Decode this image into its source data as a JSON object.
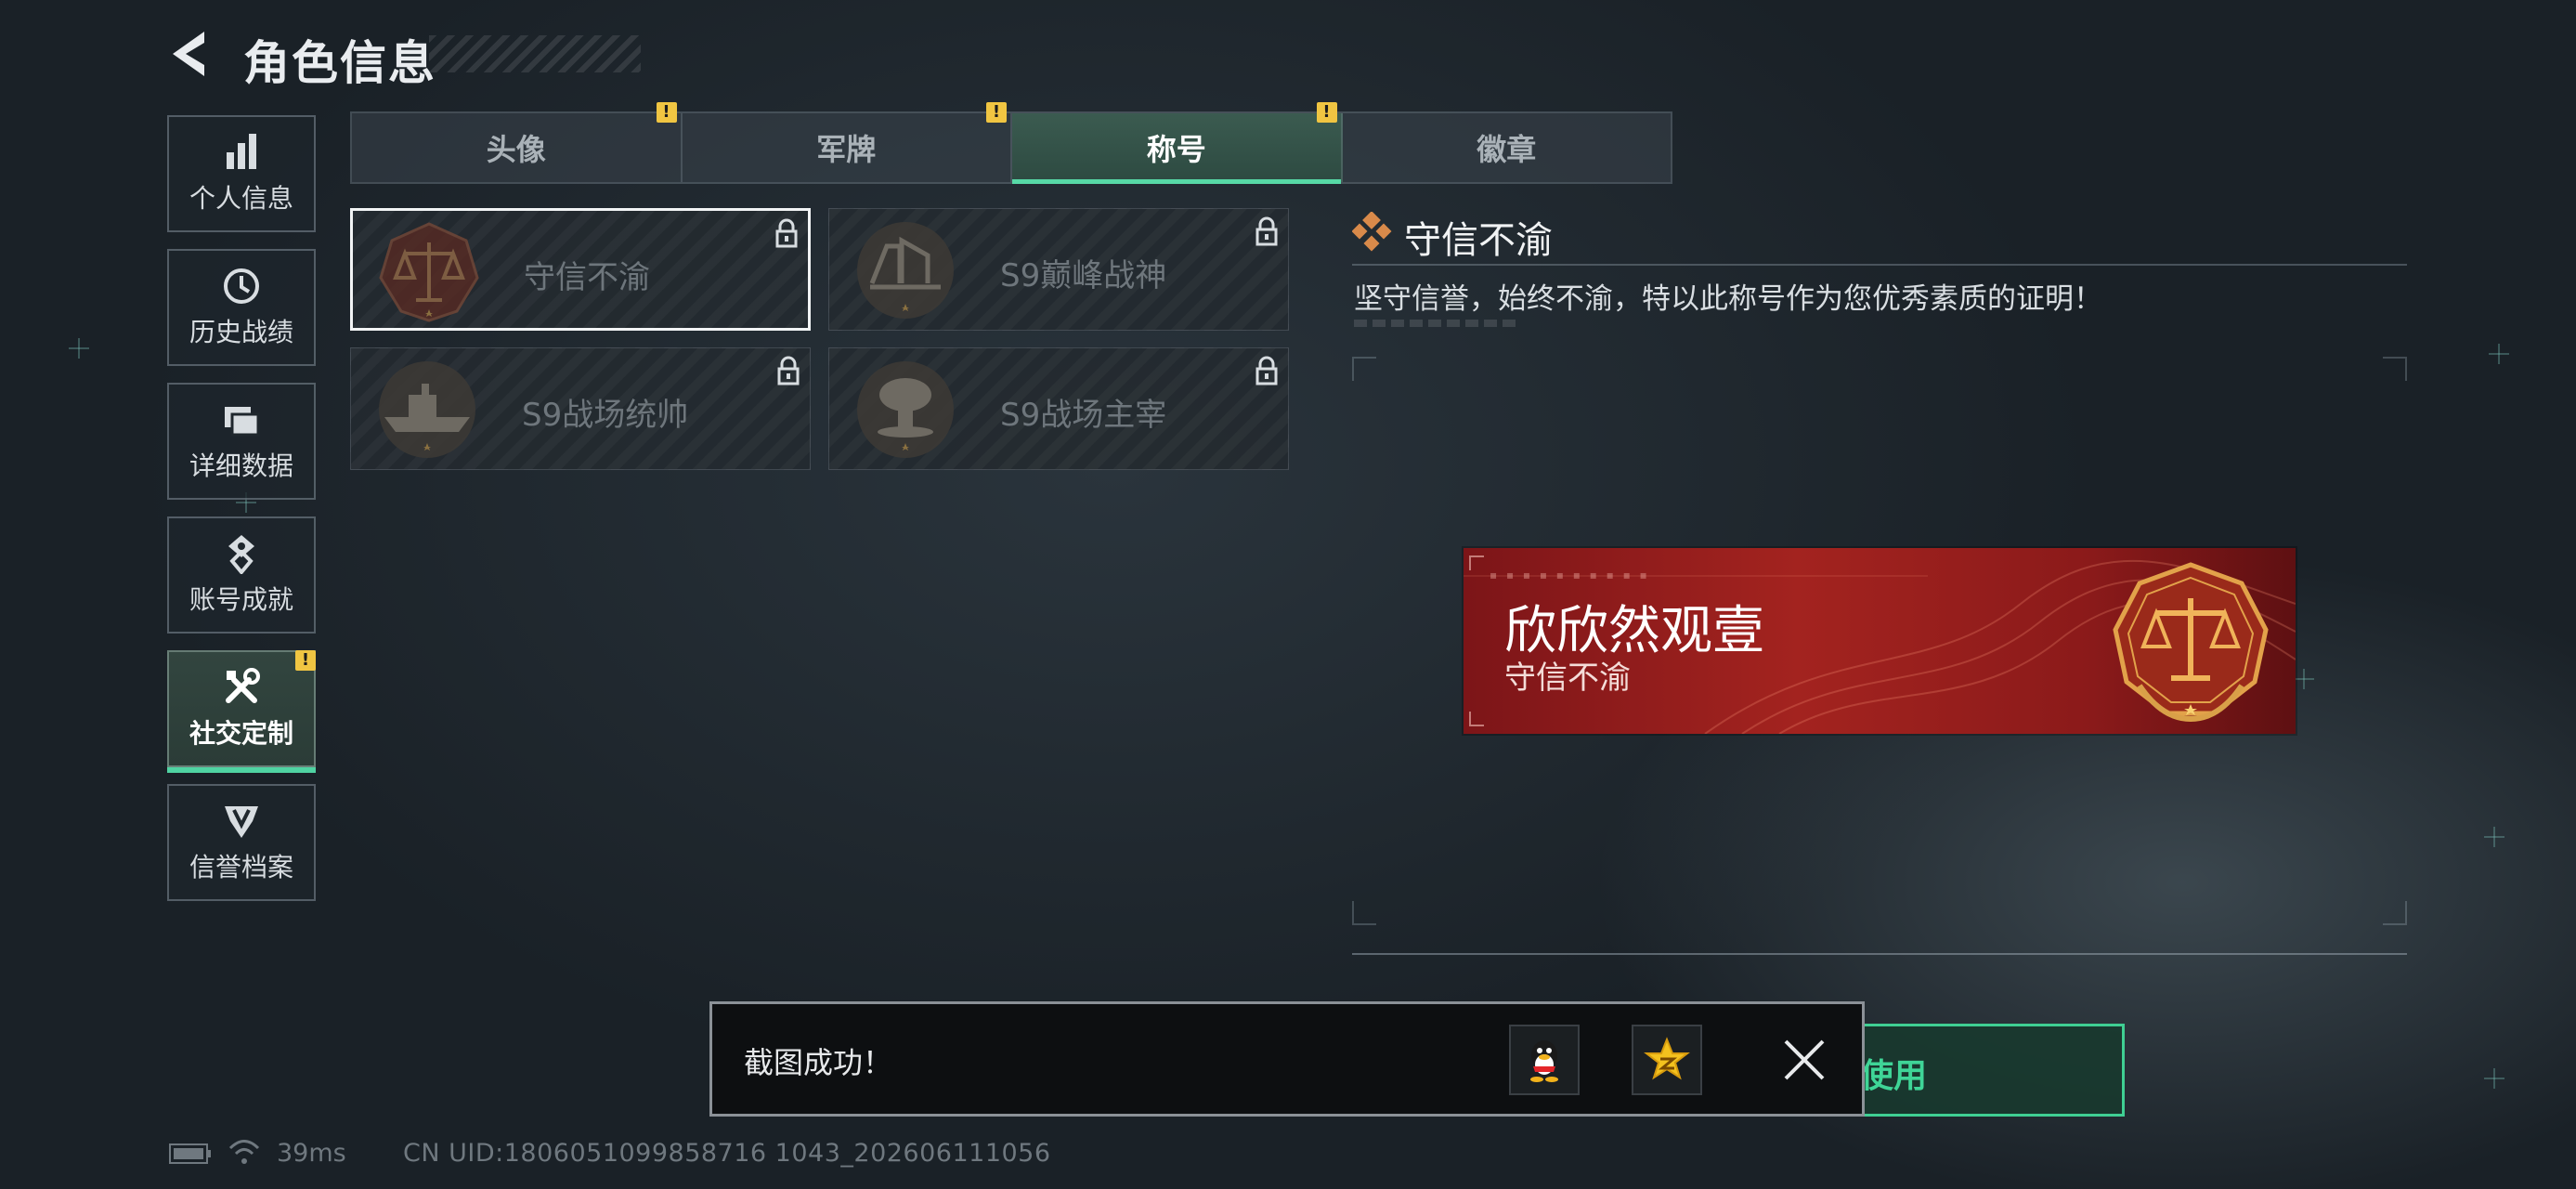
{
  "header": {
    "title": "角色信息"
  },
  "sidebar": {
    "items": [
      {
        "label": "个人信息",
        "icon": "bar-chart-icon"
      },
      {
        "label": "历史战绩",
        "icon": "clock-history-icon"
      },
      {
        "label": "详细数据",
        "icon": "folders-icon"
      },
      {
        "label": "账号成就",
        "icon": "achievement-medal-icon"
      },
      {
        "label": "社交定制",
        "icon": "tools-wrench-icon",
        "active": true,
        "badge": "!"
      },
      {
        "label": "信誉档案",
        "icon": "shield-emblem-icon"
      }
    ]
  },
  "tabs": [
    {
      "label": "头像",
      "badge": "!"
    },
    {
      "label": "军牌",
      "badge": "!"
    },
    {
      "label": "称号",
      "badge": "!",
      "active": true
    },
    {
      "label": "徽章"
    }
  ],
  "titles": [
    {
      "name": "守信不渝",
      "locked": true,
      "selected": true,
      "emblem": "scales-emblem-icon"
    },
    {
      "name": "S9巅峰战神",
      "locked": true,
      "emblem": "fortress-emblem-icon"
    },
    {
      "name": "S9战场统帅",
      "locked": true,
      "emblem": "warship-emblem-icon"
    },
    {
      "name": "S9战场主宰",
      "locked": true,
      "emblem": "mushroom-cloud-emblem-icon"
    }
  ],
  "detail": {
    "title": "守信不渝",
    "description": "坚守信誉，始终不渝，特以此称号作为您优秀素质的证明！"
  },
  "nameplate": {
    "player_name": "欣欣然观壹",
    "title": "守信不渝",
    "emblem": "scales-laurel-emblem-icon"
  },
  "use_button": {
    "label": "使用"
  },
  "toast": {
    "message": "截图成功！",
    "share_qq_icon": "qq-penguin-icon",
    "share_qzone_icon": "qzone-star-icon",
    "close_icon": "close-icon"
  },
  "footer": {
    "ping": "39ms",
    "uid": "CN UID:1806051099858716 1043_202606111056"
  },
  "colors": {
    "accent_green": "#4fd3a2",
    "warning_yellow": "#f0c542",
    "plate_red": "#a3231f",
    "background": "#1f272d"
  }
}
